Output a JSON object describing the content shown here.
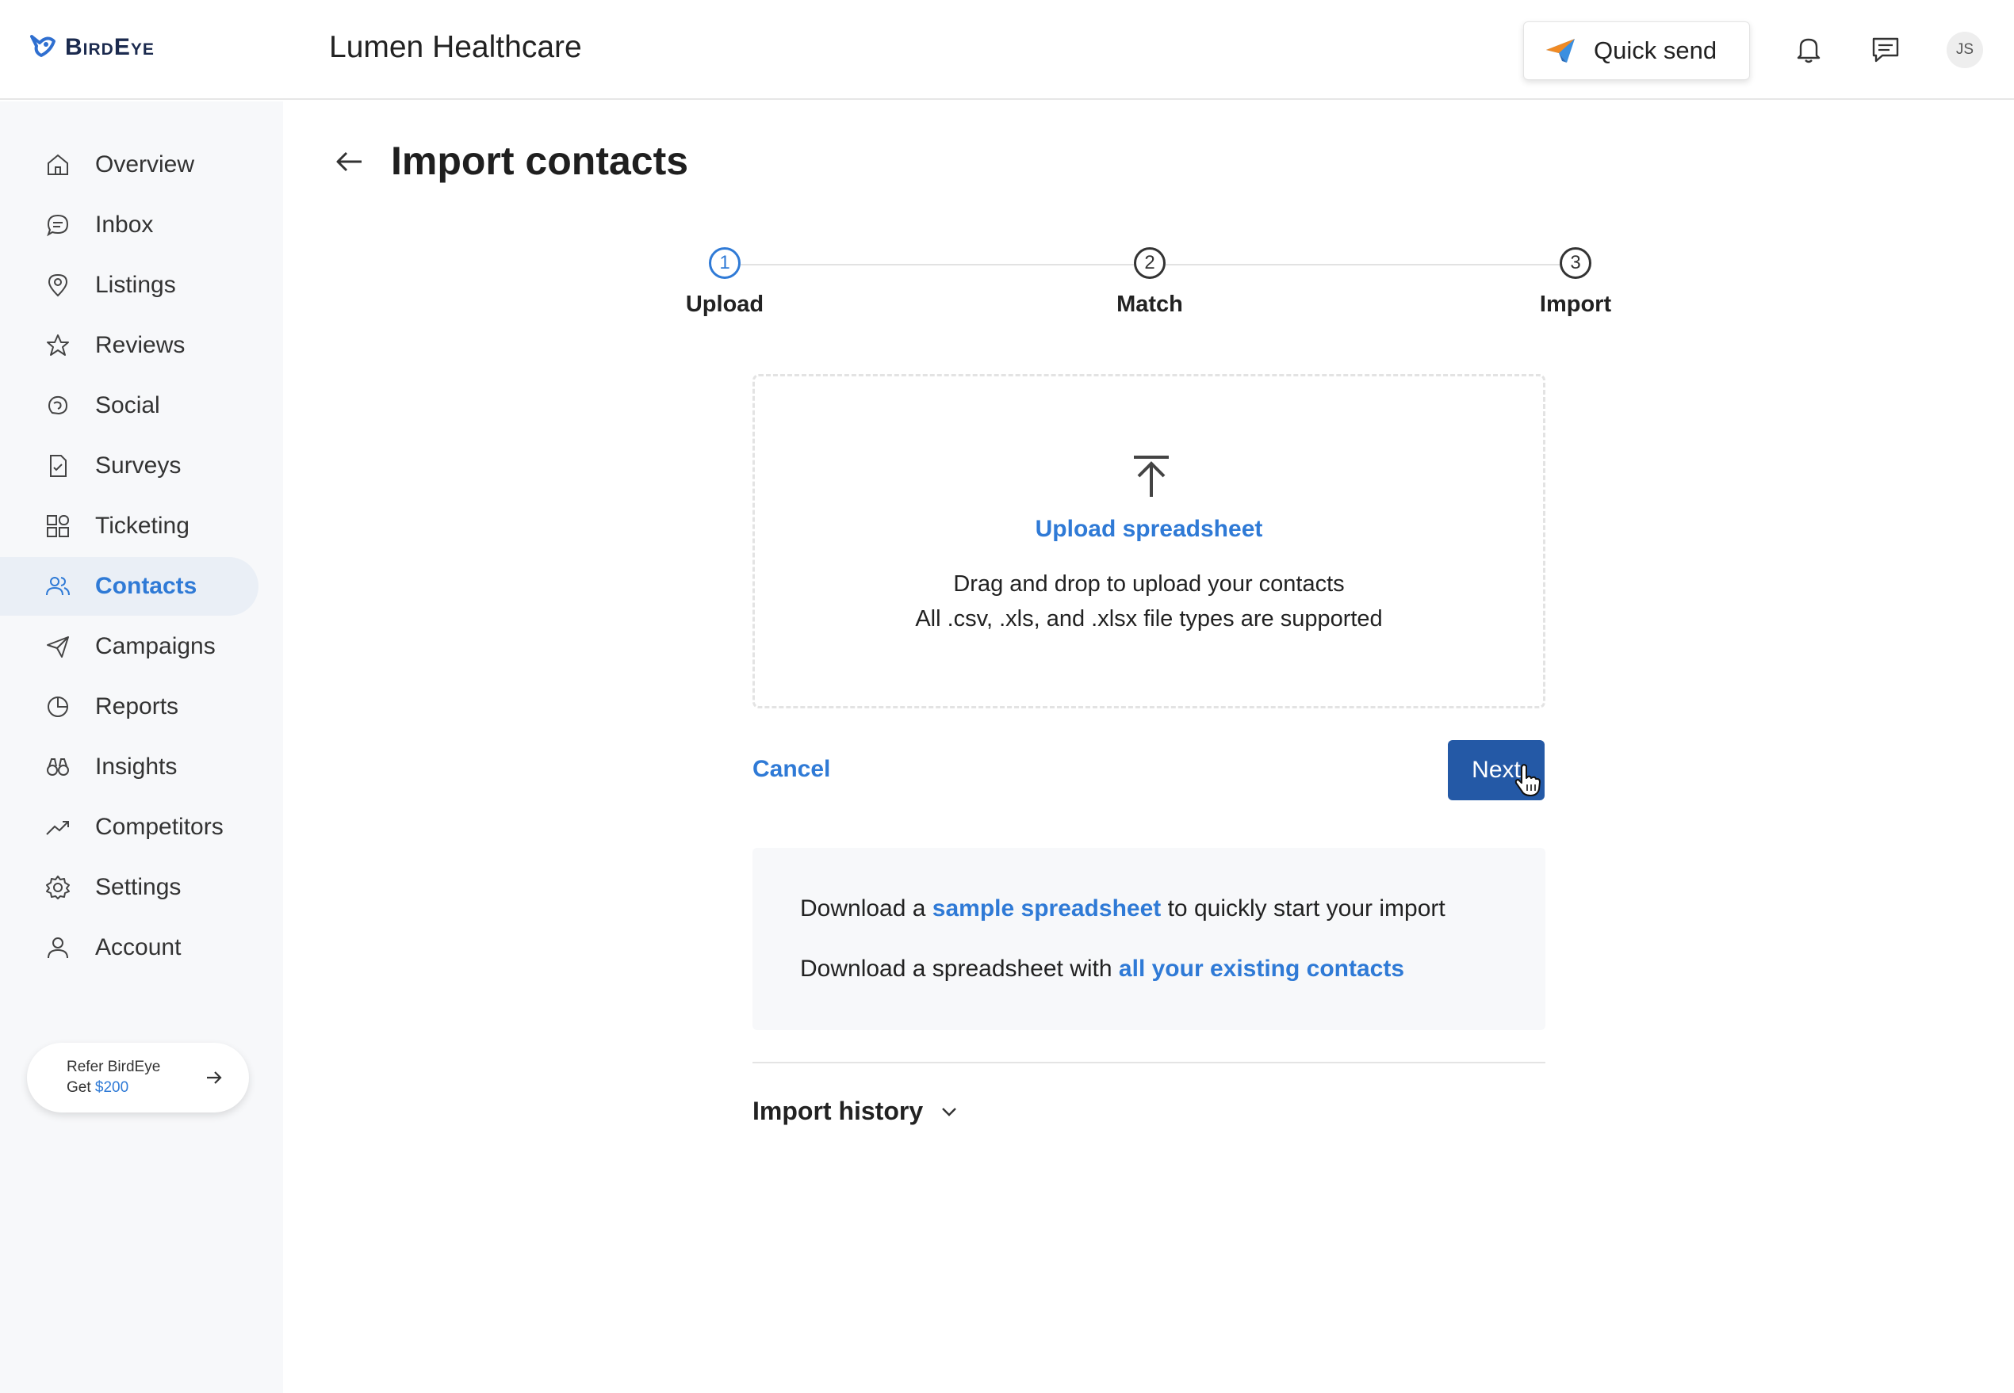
{
  "brand": {
    "name": "BirdEye"
  },
  "header": {
    "business_name": "Lumen Healthcare",
    "quick_send_label": "Quick send",
    "avatar_initials": "JS"
  },
  "sidebar": {
    "items": [
      {
        "label": "Overview",
        "icon": "home-icon"
      },
      {
        "label": "Inbox",
        "icon": "chat-bubble-icon"
      },
      {
        "label": "Listings",
        "icon": "location-pin-icon"
      },
      {
        "label": "Reviews",
        "icon": "star-icon"
      },
      {
        "label": "Social",
        "icon": "social-icon"
      },
      {
        "label": "Surveys",
        "icon": "survey-document-icon"
      },
      {
        "label": "Ticketing",
        "icon": "grid-icon"
      },
      {
        "label": "Contacts",
        "icon": "people-icon",
        "active": true
      },
      {
        "label": "Campaigns",
        "icon": "paper-plane-icon"
      },
      {
        "label": "Reports",
        "icon": "pie-chart-icon"
      },
      {
        "label": "Insights",
        "icon": "binoculars-icon"
      },
      {
        "label": "Competitors",
        "icon": "trend-up-icon"
      },
      {
        "label": "Settings",
        "icon": "gear-icon"
      },
      {
        "label": "Account",
        "icon": "person-icon"
      }
    ],
    "refer": {
      "line1": "Refer BirdEye",
      "line2_prefix": "Get ",
      "amount": "$200"
    }
  },
  "main": {
    "title": "Import contacts",
    "steps": [
      {
        "number": "1",
        "label": "Upload",
        "active": true
      },
      {
        "number": "2",
        "label": "Match",
        "active": false
      },
      {
        "number": "3",
        "label": "Import",
        "active": false
      }
    ],
    "dropzone": {
      "link": "Upload spreadsheet",
      "line1": "Drag and drop to upload your contacts",
      "line2": "All .csv, .xls, and .xlsx file types are supported"
    },
    "cancel_label": "Cancel",
    "next_label": "Next",
    "download": {
      "line1_prefix": "Download a ",
      "line1_link": "sample spreadsheet",
      "line1_suffix": " to quickly start your import",
      "line2_prefix": "Download a spreadsheet with ",
      "line2_link": "all your existing contacts"
    },
    "history_label": "Import history"
  },
  "colors": {
    "accent": "#2f7ad6",
    "primary_button": "#2459a6",
    "sidebar_bg": "#f7f8fa"
  }
}
